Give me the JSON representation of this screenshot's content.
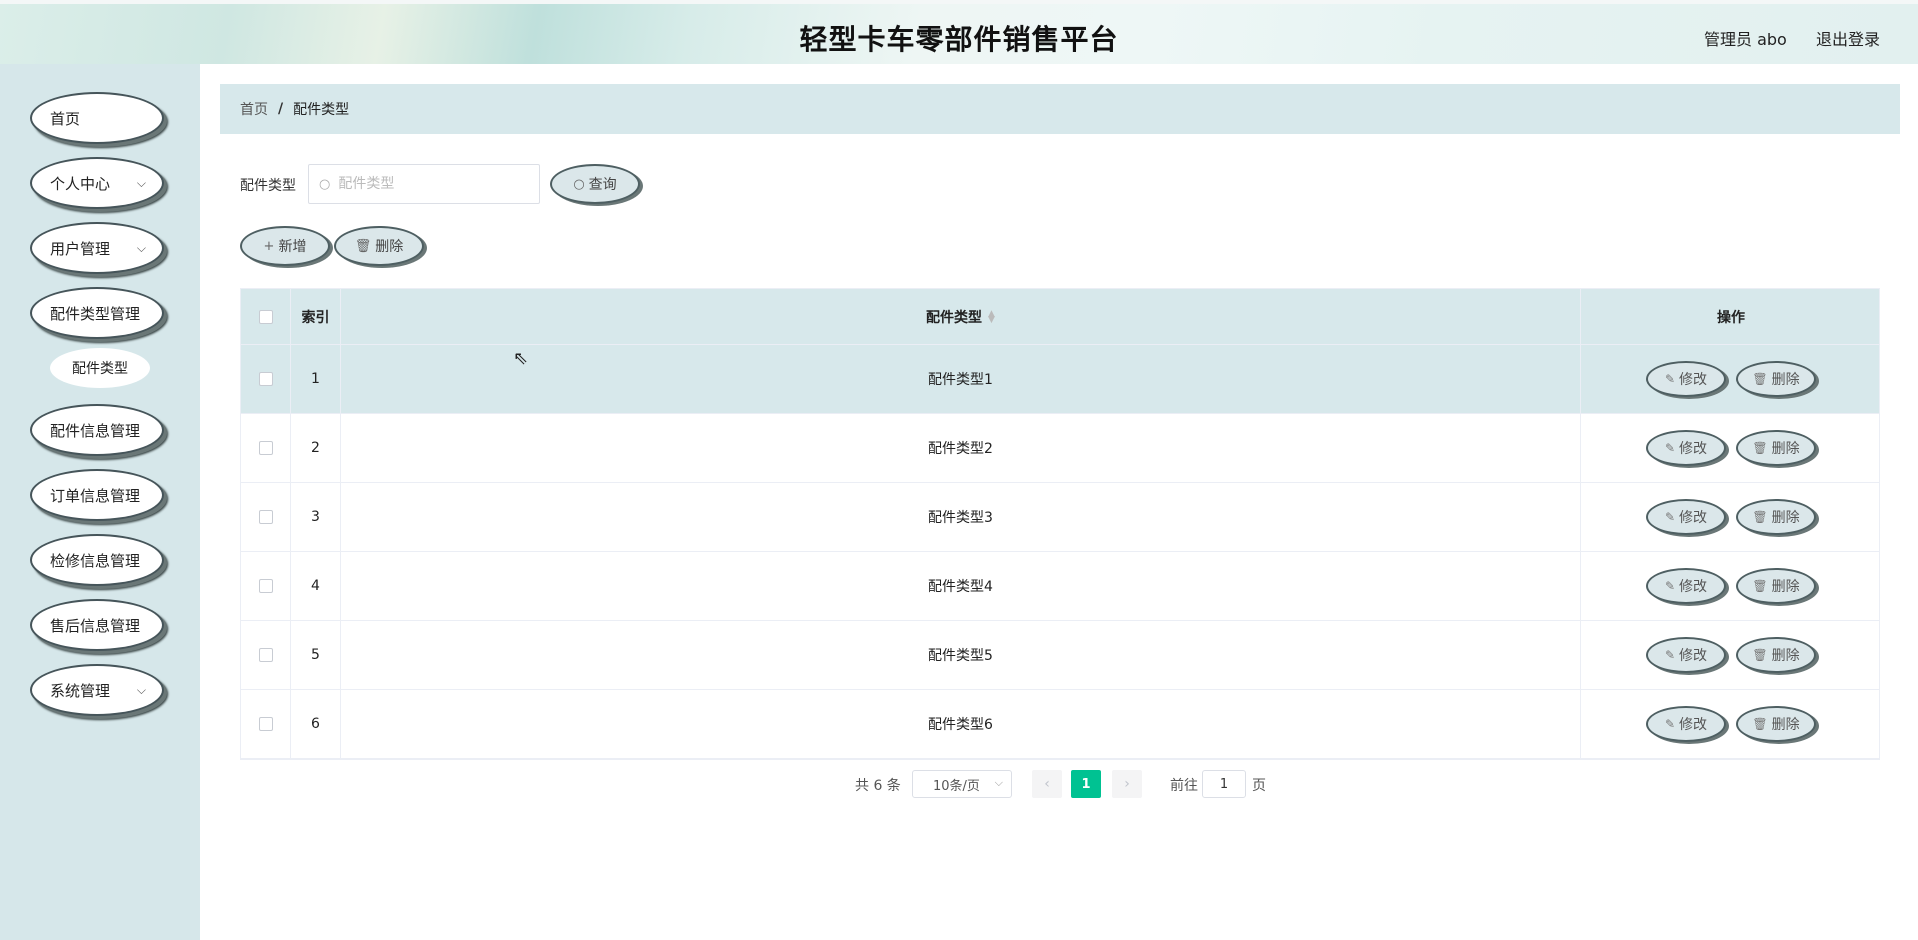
{
  "header": {
    "title": "轻型卡车零部件销售平台",
    "user": "管理员 abo",
    "logout": "退出登录"
  },
  "sidebar": {
    "items": [
      {
        "label": "首页",
        "chevron": false
      },
      {
        "label": "个人中心",
        "chevron": true
      },
      {
        "label": "用户管理",
        "chevron": true
      },
      {
        "label": "配件类型管理",
        "chevron": false
      },
      {
        "label": "配件信息管理",
        "chevron": false
      },
      {
        "label": "订单信息管理",
        "chevron": false
      },
      {
        "label": "检修信息管理",
        "chevron": false
      },
      {
        "label": "售后信息管理",
        "chevron": false
      },
      {
        "label": "系统管理",
        "chevron": true
      }
    ],
    "sub_item": "配件类型"
  },
  "breadcrumb": {
    "home": "首页",
    "separator": "/",
    "current": "配件类型"
  },
  "search": {
    "label": "配件类型",
    "placeholder": "配件类型",
    "value": "",
    "button": "查询"
  },
  "toolbar": {
    "add": "新增",
    "delete": "删除"
  },
  "table": {
    "columns": {
      "index": "索引",
      "type": "配件类型",
      "ops": "操作"
    },
    "rows": [
      {
        "index": "1",
        "type": "配件类型1"
      },
      {
        "index": "2",
        "type": "配件类型2"
      },
      {
        "index": "3",
        "type": "配件类型3"
      },
      {
        "index": "4",
        "type": "配件类型4"
      },
      {
        "index": "5",
        "type": "配件类型5"
      },
      {
        "index": "6",
        "type": "配件类型6"
      }
    ],
    "edit_label": "修改",
    "delete_label": "删除"
  },
  "pagination": {
    "total": "共 6 条",
    "page_size": "10条/页",
    "current_page": "1",
    "goto": "前往",
    "jump_value": "1",
    "page_unit": "页"
  },
  "icons": {
    "search": "search-icon",
    "add": "plus-icon",
    "delete": "trash-icon",
    "edit": "pencil-icon",
    "chevron": "chevron-down-icon"
  },
  "colors": {
    "sidebar_bg": "#d6e7ea",
    "header_bg": "#cfe7e2",
    "accent": "#00c292",
    "row_highlight": "#d7e8eb"
  }
}
